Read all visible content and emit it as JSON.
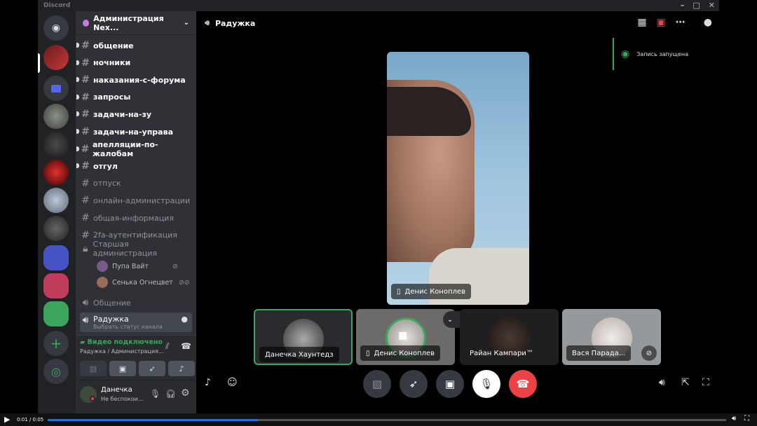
{
  "window": {
    "app_name": "Discord",
    "minimize": "–",
    "maximize": "□",
    "close": "✕"
  },
  "server": {
    "name": "Администрация Nex...",
    "chevron": "⌄"
  },
  "channels": [
    {
      "label": "общение",
      "state": "unread"
    },
    {
      "label": "ночники",
      "state": "unread"
    },
    {
      "label": "наказания-с-форума",
      "state": "unread"
    },
    {
      "label": "запросы",
      "state": "unread"
    },
    {
      "label": "задачи-на-зу",
      "state": "unread"
    },
    {
      "label": "задачи-на-управа",
      "state": "unread"
    },
    {
      "label": "апелляции-по-жалобам",
      "state": "unread"
    },
    {
      "label": "отгул",
      "state": "unread"
    },
    {
      "label": "отпуск",
      "state": "read"
    },
    {
      "label": "онлайн-администрации",
      "state": "read"
    },
    {
      "label": "общая-информация",
      "state": "read"
    },
    {
      "label": "2fa-аутентификация",
      "state": "read"
    }
  ],
  "voice_channels": {
    "senior": "Старшая администрация",
    "senior_users": [
      "Пупа Вайт",
      "Сенька Огнецвет"
    ],
    "general": "Общение",
    "current": "Радужка",
    "current_status_placeholder": "Выбрать статус канала"
  },
  "voice_panel": {
    "status": "Видео подключено",
    "location": "Радужка / Администрация..."
  },
  "user": {
    "name": "Данечка",
    "status": "Не беспокои..."
  },
  "header": {
    "channel_title": "Радужка"
  },
  "recording": {
    "label": "Запись запущена"
  },
  "stage": {
    "name": "Денис Коноплев"
  },
  "tiles": [
    {
      "name": "Данечка Хаунтедз"
    },
    {
      "name": "Денис Коноплев"
    },
    {
      "name": "Райан Кампари™"
    },
    {
      "name": "Вася Парада..."
    }
  ],
  "player": {
    "time": "0:01 / 0:05",
    "progress_fraction": 0.31
  },
  "colors": {
    "accent_green": "#3ba55d",
    "hangup_red": "#ed4245",
    "blurple": "#5865f2"
  }
}
